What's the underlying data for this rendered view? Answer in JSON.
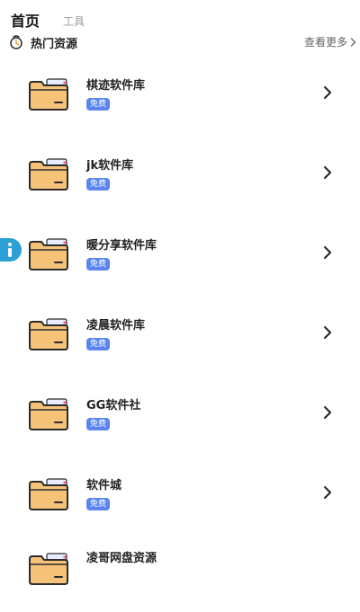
{
  "tabs": [
    {
      "label": "首页",
      "active": true
    },
    {
      "label": "工具",
      "active": false
    }
  ],
  "section": {
    "title": "热门资源",
    "see_more": "查看更多",
    "icon": "fire-clock-icon"
  },
  "items": [
    {
      "name": "棋迹软件库",
      "badge": "免费",
      "icon": "folder-icon"
    },
    {
      "name": "jk软件库",
      "badge": "免费",
      "icon": "folder-icon"
    },
    {
      "name": "暖分享软件库",
      "badge": "免费",
      "icon": "folder-icon"
    },
    {
      "name": "凌晨软件库",
      "badge": "免费",
      "icon": "folder-icon"
    },
    {
      "name": "GG软件社",
      "badge": "免费",
      "icon": "folder-icon"
    },
    {
      "name": "软件城",
      "badge": "免费",
      "icon": "folder-icon"
    },
    {
      "name": "凌哥网盘资源",
      "badge": "",
      "icon": "folder-icon"
    }
  ],
  "floating": {
    "icon": "info-icon"
  },
  "colors": {
    "badge_bg": "#5b86f2",
    "folder_body": "#f6c27a",
    "folder_outline": "#2b2b2b",
    "folder_paper": "#e8ecff",
    "info_blue": "#2b9fd6"
  }
}
